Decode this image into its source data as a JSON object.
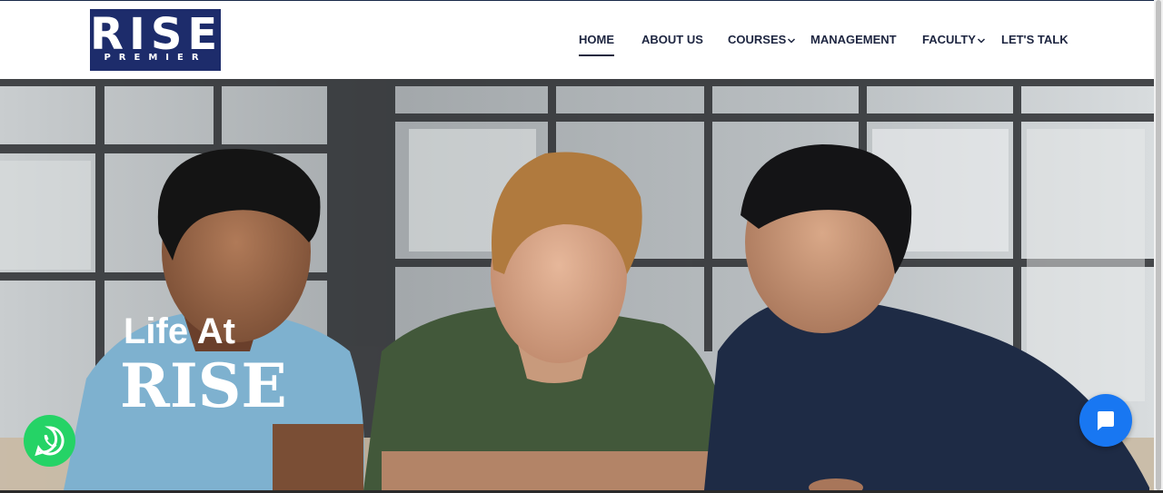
{
  "logo": {
    "main": "RISE",
    "sub": "PREMIER"
  },
  "nav": {
    "items": [
      {
        "label": "HOME",
        "active": true
      },
      {
        "label": "ABOUT US"
      },
      {
        "label": "COURSES",
        "dropdown": true
      },
      {
        "label": "MANAGEMENT"
      },
      {
        "label": "FACULTY",
        "dropdown": true
      },
      {
        "label": "LET'S TALK"
      }
    ]
  },
  "hero": {
    "line1": "Life At",
    "line2": "RISE",
    "image": "three young men sitting together looking down at a laptop in an office with large windows"
  },
  "widgets": {
    "whatsapp_icon": "whatsapp-icon",
    "chat_icon": "chat-bubble-icon"
  },
  "colors": {
    "brand_navy": "#1d2c6b",
    "nav_text": "#1d2540",
    "whatsapp_green": "#25d366",
    "chat_blue": "#1877f2"
  }
}
